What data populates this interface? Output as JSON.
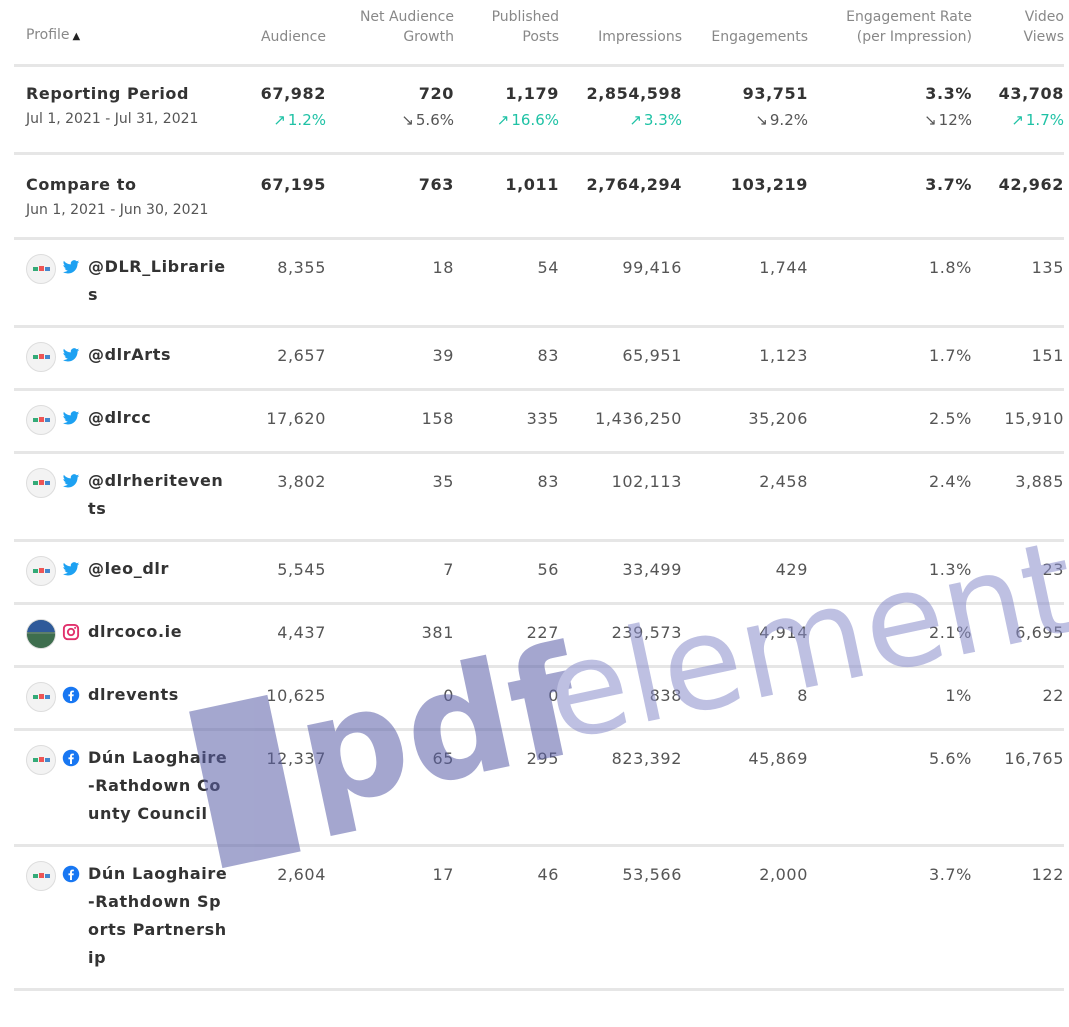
{
  "header": {
    "profile": "Profile",
    "audience": "Audience",
    "net_growth_1": "Net Audience",
    "net_growth_2": "Growth",
    "published_1": "Published",
    "published_2": "Posts",
    "impressions": "Impressions",
    "engagements": "Engagements",
    "eng_rate_1": "Engagement Rate",
    "eng_rate_2": "(per Impression)",
    "video_1": "Video",
    "video_2": "Views"
  },
  "reporting": {
    "title": "Reporting Period",
    "dates": "Jul 1, 2021 - Jul 31, 2021",
    "audience": "67,982",
    "audience_change": "1.2%",
    "growth": "720",
    "growth_change": "5.6%",
    "posts": "1,179",
    "posts_change": "16.6%",
    "impressions": "2,854,598",
    "impressions_change": "3.3%",
    "engagements": "93,751",
    "engagements_change": "9.2%",
    "rate": "3.3%",
    "rate_change": "12%",
    "video": "43,708",
    "video_change": "1.7%"
  },
  "compare": {
    "title": "Compare to",
    "dates": "Jun 1, 2021 - Jun 30, 2021",
    "audience": "67,195",
    "growth": "763",
    "posts": "1,011",
    "impressions": "2,764,294",
    "engagements": "103,219",
    "rate": "3.7%",
    "video": "42,962"
  },
  "profiles": [
    {
      "name": "@DLR_Libraries",
      "network": "twitter",
      "audience": "8,355",
      "growth": "18",
      "posts": "54",
      "impressions": "99,416",
      "engagements": "1,744",
      "rate": "1.8%",
      "video": "135"
    },
    {
      "name": "@dlrArts",
      "network": "twitter",
      "audience": "2,657",
      "growth": "39",
      "posts": "83",
      "impressions": "65,951",
      "engagements": "1,123",
      "rate": "1.7%",
      "video": "151"
    },
    {
      "name": "@dlrcc",
      "network": "twitter",
      "audience": "17,620",
      "growth": "158",
      "posts": "335",
      "impressions": "1,436,250",
      "engagements": "35,206",
      "rate": "2.5%",
      "video": "15,910"
    },
    {
      "name": "@dlrheritevents",
      "network": "twitter",
      "audience": "3,802",
      "growth": "35",
      "posts": "83",
      "impressions": "102,113",
      "engagements": "2,458",
      "rate": "2.4%",
      "video": "3,885"
    },
    {
      "name": "@leo_dlr",
      "network": "twitter",
      "audience": "5,545",
      "growth": "7",
      "posts": "56",
      "impressions": "33,499",
      "engagements": "429",
      "rate": "1.3%",
      "video": "23"
    },
    {
      "name": "dlrcoco.ie",
      "network": "instagram",
      "audience": "4,437",
      "growth": "381",
      "posts": "227",
      "impressions": "239,573",
      "engagements": "4,914",
      "rate": "2.1%",
      "video": "6,695"
    },
    {
      "name": "dlrevents",
      "network": "facebook",
      "audience": "10,625",
      "growth": "0",
      "posts": "0",
      "impressions": "838",
      "engagements": "8",
      "rate": "1%",
      "video": "22"
    },
    {
      "name": "Dún Laoghaire-Rathdown County Council",
      "network": "facebook",
      "audience": "12,337",
      "growth": "65",
      "posts": "295",
      "impressions": "823,392",
      "engagements": "45,869",
      "rate": "5.6%",
      "video": "16,765"
    },
    {
      "name": "Dún Laoghaire-Rathdown Sports Partnership",
      "network": "facebook",
      "audience": "2,604",
      "growth": "17",
      "posts": "46",
      "impressions": "53,566",
      "engagements": "2,000",
      "rate": "3.7%",
      "video": "122"
    }
  ],
  "watermark": "pdfelement",
  "colors": {
    "up": "#1fc2a5",
    "twitter": "#1da1f2",
    "instagram": "#e1306c",
    "facebook": "#1877f2",
    "watermark": "#5a5fa8"
  }
}
